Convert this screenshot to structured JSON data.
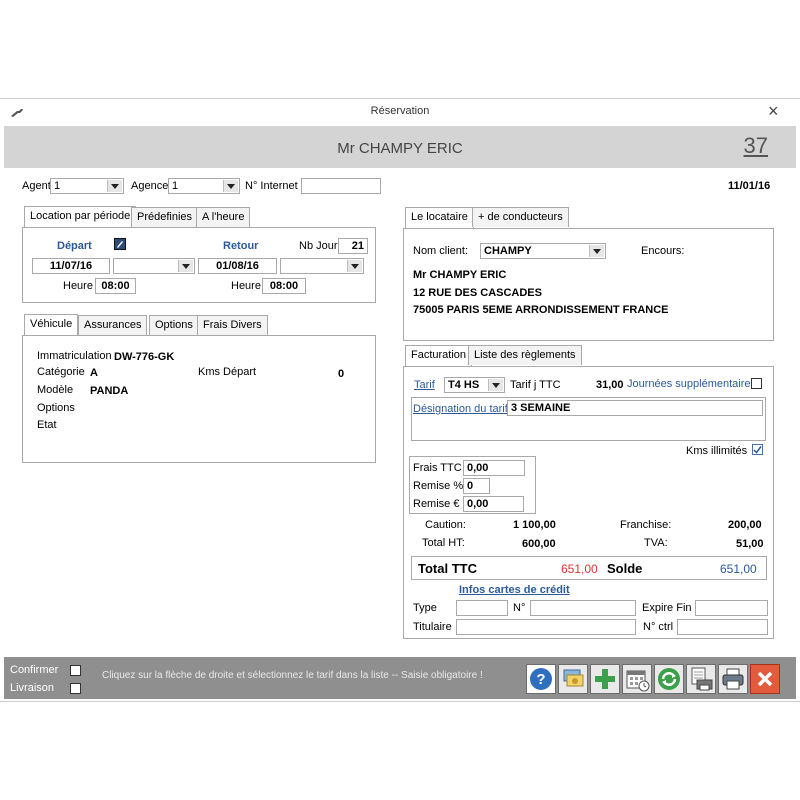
{
  "window": {
    "title": "Réservation",
    "close": "×"
  },
  "header": {
    "client_name": "Mr CHAMPY ERIC",
    "reservation_number": "37"
  },
  "top": {
    "agent_label": "Agent",
    "agent_value": "1",
    "agence_label": "Agence",
    "agence_value": "1",
    "internet_label": "N° Internet",
    "internet_value": "",
    "date": "11/01/16"
  },
  "period_tabs": [
    "Location par période",
    "Prédefinies",
    "A l'heure"
  ],
  "period": {
    "depart_label": "Départ",
    "retour_label": "Retour",
    "nbjour_label": "Nb Jour",
    "nbjour_value": "21",
    "depart_date": "11/07/16",
    "retour_date": "01/08/16",
    "heure_label": "Heure",
    "depart_heure": "08:00",
    "retour_heure": "08:00"
  },
  "vehicle_tabs": [
    "Véhicule",
    "Assurances",
    "Options",
    "Frais Divers"
  ],
  "vehicle": {
    "immat_label": "Immatriculation",
    "immat_value": "DW-776-GK",
    "categorie_label": "Catégorie",
    "categorie_value": "A",
    "kms_label": "Kms Départ",
    "kms_value": "0",
    "modele_label": "Modèle",
    "modele_value": "PANDA",
    "options_label": "Options",
    "etat_label": "Etat"
  },
  "locataire_tabs": [
    "Le locataire",
    "+ de conducteurs"
  ],
  "locataire": {
    "nom_label": "Nom client:",
    "nom_value": "CHAMPY",
    "encours_label": "Encours:",
    "line1": "Mr CHAMPY ERIC",
    "line2": "12 RUE DES CASCADES",
    "line3": "75005 PARIS 5EME ARRONDISSEMENT FRANCE"
  },
  "billing_tabs": [
    "Facturation",
    "Liste des règlements"
  ],
  "billing": {
    "tarif_label": "Tarif",
    "tarif_value": "T4 HS",
    "tarif_j_label": "Tarif j TTC",
    "tarif_j_value": "31,00",
    "journees_label": "Journées supplémentaires",
    "designation_label": "Désignation du tarif",
    "designation_value": "3 SEMAINE",
    "kms_illimites_label": "Kms illimités",
    "frais_label": "Frais TTC",
    "frais_value": "0,00",
    "remise_pct_label": "Remise %",
    "remise_pct_value": "0",
    "remise_eur_label": "Remise €",
    "remise_eur_value": "0,00",
    "caution_label": "Caution:",
    "caution_value": "1 100,00",
    "franchise_label": "Franchise:",
    "franchise_value": "200,00",
    "total_ht_label": "Total HT:",
    "total_ht_value": "600,00",
    "tva_label": "TVA:",
    "tva_value": "51,00",
    "total_ttc_label": "Total TTC",
    "total_ttc_value": "651,00",
    "solde_label": "Solde",
    "solde_value": "651,00"
  },
  "credit": {
    "title": "Infos cartes de crédit",
    "type_label": "Type",
    "no_label": "N°",
    "expire_label": "Expire Fin",
    "titulaire_label": "Titulaire",
    "ctrl_label": "N° ctrl"
  },
  "footer": {
    "confirmer_label": "Confirmer",
    "livraison_label": "Livraison",
    "message": "Cliquez sur la flèche de droite et sélectionnez le tarif dans la liste -- Saisie obligatoire !"
  },
  "toolbar": [
    "help-icon",
    "payment-icon",
    "add-icon",
    "calendar-icon",
    "refresh-icon",
    "print-preview-icon",
    "print-icon",
    "close-icon"
  ],
  "colors": {
    "header_bg": "#d4d4d4",
    "footer_bg": "#8f8f8f",
    "link": "#2a5a9a",
    "total_red": "#dd3333",
    "close_red": "#e25b3c"
  }
}
